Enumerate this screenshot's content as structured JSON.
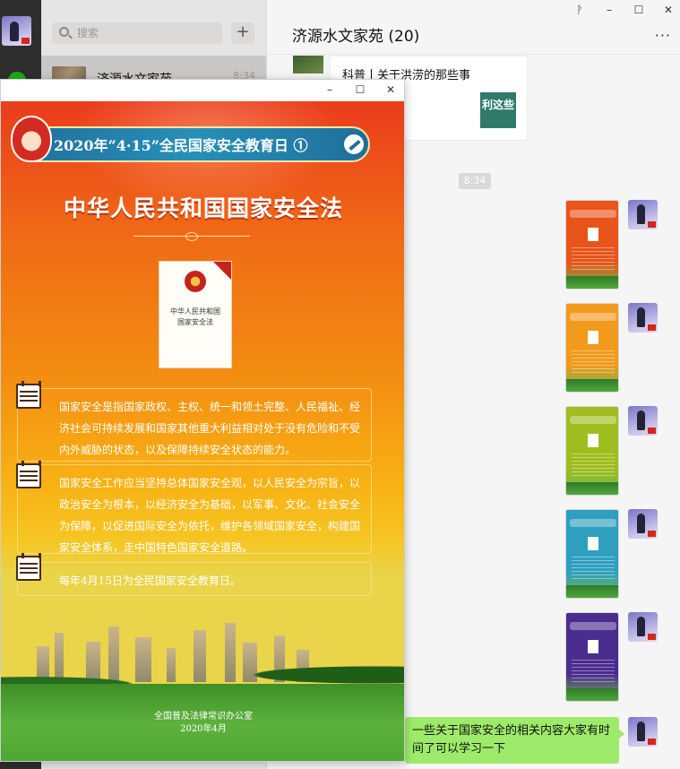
{
  "app": {
    "search_placeholder": "搜索",
    "add_label": "+",
    "session": {
      "name": "济源水文家苑",
      "time": "8:34"
    }
  },
  "chat": {
    "title": "济源水文家苑 (20)",
    "more_label": "···",
    "window_buttons": {
      "pin": "ᚹ",
      "min": "–",
      "max": "☐",
      "close": "✕"
    },
    "link_card": {
      "title": "科普丨关于洪涝的那些事",
      "thumb_text": "利这些"
    },
    "time_chip": "8:34",
    "image_messages": [
      {
        "accent": "#e8541a"
      },
      {
        "accent": "#f19a1b"
      },
      {
        "accent": "#9fbd1e"
      },
      {
        "accent": "#2f9fc0"
      },
      {
        "accent": "#4b2c8f"
      }
    ],
    "text_message": "一些关于国家安全的相关内容大家有时间了可以学习一下"
  },
  "viewer": {
    "window_buttons": {
      "min": "–",
      "max": "☐",
      "close": "✕"
    },
    "poster": {
      "banner": "2020年“4·15”全民国家安全教育日 ①",
      "title": "中华人民共和国国家安全法",
      "book_title": "中华人民共和国\n国家安全法",
      "paragraphs": [
        "国家安全是指国家政权、主权、统一和领土完整、人民福祉、经济社会可持续发展和国家其他重大利益相对处于没有危险和不受内外威胁的状态，以及保障持续安全状态的能力。",
        "国家安全工作应当坚持总体国家安全观，以人民安全为宗旨，以政治安全为根本，以经济安全为基础，以军事、文化、社会安全为保障，以促进国际安全为依托，维护各领域国家安全，构建国家安全体系，走中国特色国家安全道路。",
        "每年4月15日为全民国家安全教育日。"
      ],
      "footer_org": "全国普及法律常识办公室",
      "footer_date": "2020年4月"
    }
  },
  "colors": {
    "sidebar": "#2e2e2e",
    "list_bg": "#e6e5e5",
    "chat_bg": "#f5f5f5",
    "bubble_green": "#9eea6a"
  }
}
